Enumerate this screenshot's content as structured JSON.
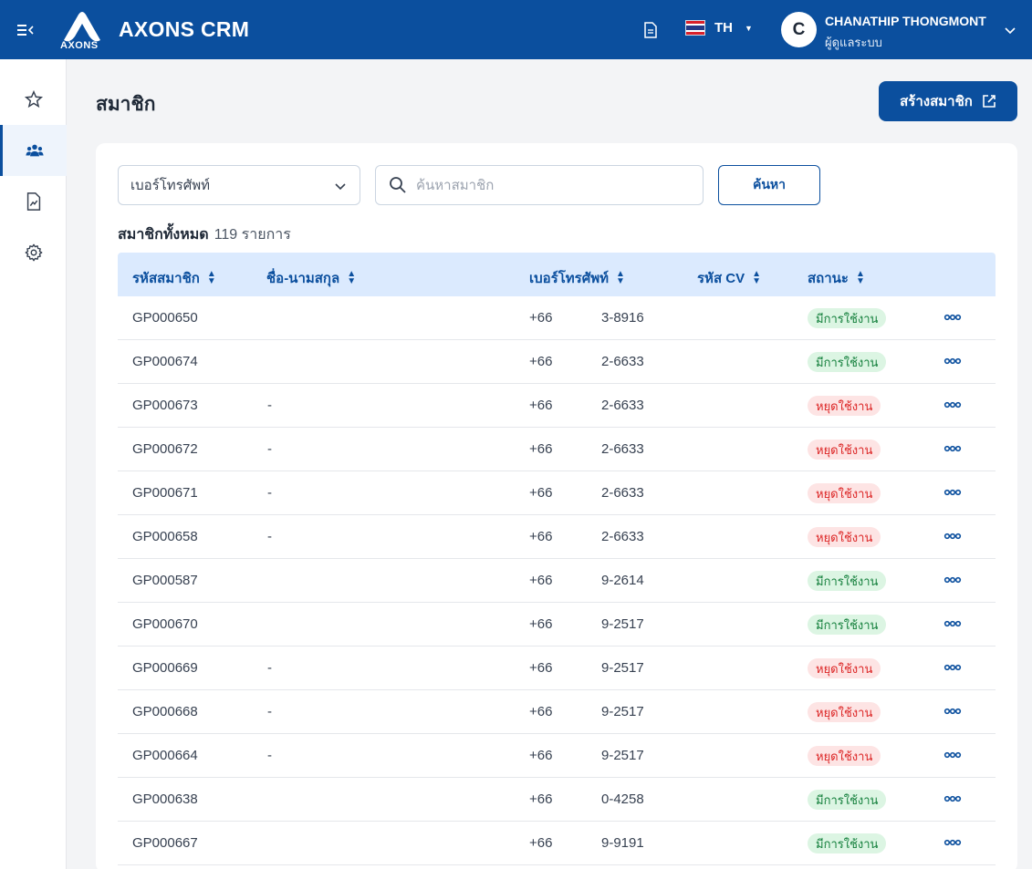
{
  "app": {
    "title": "AXONS CRM",
    "logo_text": "AXONS"
  },
  "header": {
    "language": "TH",
    "user": {
      "initial": "C",
      "name": "CHANATHIP THONGMONT",
      "role": "ผู้ดูแลระบบ"
    }
  },
  "sidebar": {
    "items": [
      "favorites",
      "members",
      "reports",
      "settings"
    ],
    "active": "members"
  },
  "page": {
    "title": "สมาชิก",
    "create_label": "สร้างสมาชิก"
  },
  "filters": {
    "select_value": "เบอร์โทรศัพท์",
    "search_placeholder": "ค้นหาสมาชิก",
    "search_button": "ค้นหา"
  },
  "summary": {
    "label": "สมาชิกทั้งหมด",
    "count": "119 รายการ"
  },
  "table": {
    "columns": [
      "รหัสสมาชิก",
      "ชื่อ-นามสกุล",
      "เบอร์โทรศัพท์",
      "รหัส CV",
      "สถานะ"
    ],
    "rows": [
      {
        "id": "GP000650",
        "name": "",
        "phone_prefix": "+66",
        "phone_suffix": "3-8916",
        "status": "มีการใช้งาน",
        "status_type": "active"
      },
      {
        "id": "GP000674",
        "name": "",
        "phone_prefix": "+66",
        "phone_suffix": "2-6633",
        "status": "มีการใช้งาน",
        "status_type": "active"
      },
      {
        "id": "GP000673",
        "name": "-",
        "phone_prefix": "+66",
        "phone_suffix": "2-6633",
        "status": "หยุดใช้งาน",
        "status_type": "inactive"
      },
      {
        "id": "GP000672",
        "name": "-",
        "phone_prefix": "+66",
        "phone_suffix": "2-6633",
        "status": "หยุดใช้งาน",
        "status_type": "inactive"
      },
      {
        "id": "GP000671",
        "name": "-",
        "phone_prefix": "+66",
        "phone_suffix": "2-6633",
        "status": "หยุดใช้งาน",
        "status_type": "inactive"
      },
      {
        "id": "GP000658",
        "name": "-",
        "phone_prefix": "+66",
        "phone_suffix": "2-6633",
        "status": "หยุดใช้งาน",
        "status_type": "inactive"
      },
      {
        "id": "GP000587",
        "name": "",
        "phone_prefix": "+66",
        "phone_suffix": "9-2614",
        "status": "มีการใช้งาน",
        "status_type": "active"
      },
      {
        "id": "GP000670",
        "name": "",
        "phone_prefix": "+66",
        "phone_suffix": "9-2517",
        "status": "มีการใช้งาน",
        "status_type": "active"
      },
      {
        "id": "GP000669",
        "name": "-",
        "phone_prefix": "+66",
        "phone_suffix": "9-2517",
        "status": "หยุดใช้งาน",
        "status_type": "inactive"
      },
      {
        "id": "GP000668",
        "name": "-",
        "phone_prefix": "+66",
        "phone_suffix": "9-2517",
        "status": "หยุดใช้งาน",
        "status_type": "inactive"
      },
      {
        "id": "GP000664",
        "name": "-",
        "phone_prefix": "+66",
        "phone_suffix": "9-2517",
        "status": "หยุดใช้งาน",
        "status_type": "inactive"
      },
      {
        "id": "GP000638",
        "name": "",
        "phone_prefix": "+66",
        "phone_suffix": "0-4258",
        "status": "มีการใช้งาน",
        "status_type": "active"
      },
      {
        "id": "GP000667",
        "name": "",
        "phone_prefix": "+66",
        "phone_suffix": "9-9191",
        "status": "มีการใช้งาน",
        "status_type": "active"
      }
    ]
  },
  "colors": {
    "brand": "#0b4f9e",
    "active_bg": "#dcf5e3",
    "active_text": "#15803d",
    "inactive_bg": "#fde4e4",
    "inactive_text": "#dc2626"
  }
}
